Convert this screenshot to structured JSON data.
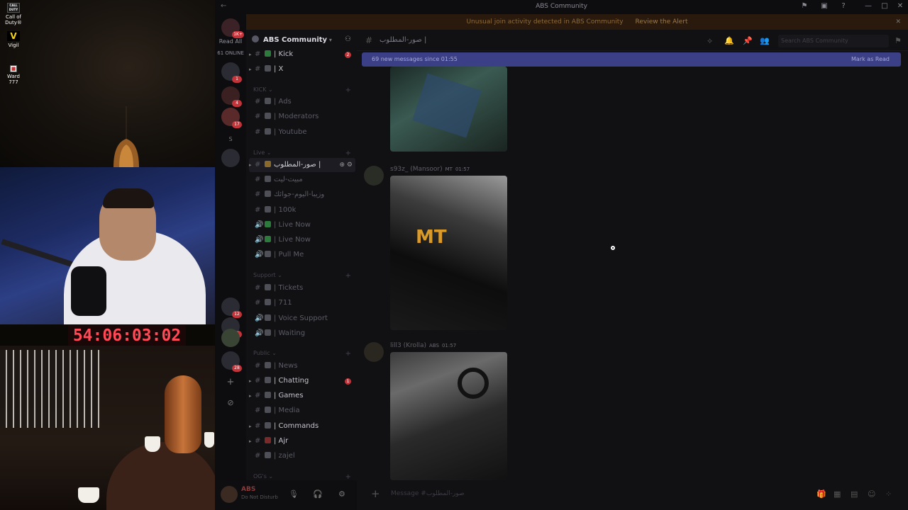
{
  "stream": {
    "desktop_icons": [
      {
        "label": "Call of Duty®",
        "glyph": "CALL DUTY"
      },
      {
        "label": "Vigil",
        "glyph": "V"
      },
      {
        "label": "Ward 777",
        "glyph": "■"
      }
    ],
    "timer": "54:06:03:02"
  },
  "window": {
    "title": "ABS Community",
    "back_glyph": "←",
    "controls": [
      "⚑",
      "▣",
      "?",
      "—",
      "□",
      "✕"
    ]
  },
  "alert": {
    "text": "Unusual join activity detected in ABS Community",
    "link": "Review the Alert",
    "close": "✕"
  },
  "rail": {
    "read_all_badge": "1K+",
    "read_all_label": "Read All",
    "online_label": "61 ONLINE",
    "servers": [
      {
        "badge": "1"
      },
      {
        "badge": "4"
      },
      {
        "badge": "17"
      },
      {
        "label": "S"
      },
      {
        "badge": ""
      },
      {
        "badge": "12"
      },
      {
        "badge": "7"
      },
      {
        "badge": ""
      },
      {
        "badge": "28"
      }
    ],
    "add_label": "+",
    "discover_label": "⊘"
  },
  "sidebar": {
    "server_name": "ABS Community",
    "pinned": [
      {
        "label": "| Kick",
        "badge": "2"
      },
      {
        "label": "| X"
      }
    ],
    "categories": [
      {
        "name": "KICK",
        "channels": [
          "| Ads",
          "| Moderators",
          "| Youtube"
        ]
      },
      {
        "name": "Live",
        "channels": [
          "صور-المطلوب |",
          "مبيت-ليت",
          "وزيبا-اليوم-جوائك",
          "| 100k",
          "| Live Now",
          "| Live Now",
          "| Pull Me"
        ]
      },
      {
        "name": "Support",
        "channels": [
          "| Tickets",
          "| 711",
          "| Voice Support",
          "| Waiting"
        ]
      },
      {
        "name": "Public",
        "channels": [
          "| News",
          "| Chatting",
          "| Games",
          "| Media",
          "| Commands",
          "| Ajr",
          "| zajel"
        ]
      },
      {
        "name": "OG's",
        "channels": []
      }
    ],
    "active_channel_tools": "⊕ ⚙",
    "chatting_badge": "1"
  },
  "user": {
    "name": "ABS",
    "status": "Do Not Disturb"
  },
  "chat": {
    "channel_name": "صور-المطلوب |",
    "search_placeholder": "Search ABS Community",
    "new_messages": "69 new messages since 01:55",
    "mark_read": "Mark as Read",
    "messages": [
      {
        "author": "s93z_ (Mansoor)",
        "tags": "MT",
        "time": "01:57"
      },
      {
        "author": "lill3 (Krolla)",
        "tags": "ABS",
        "time": "01:57"
      }
    ],
    "composer_placeholder": "Message #صور-المطلوب"
  },
  "colors": {
    "accent_bar": "#3b3f86",
    "badge_red": "#c2343a",
    "timer_red": "#ff4a57"
  }
}
